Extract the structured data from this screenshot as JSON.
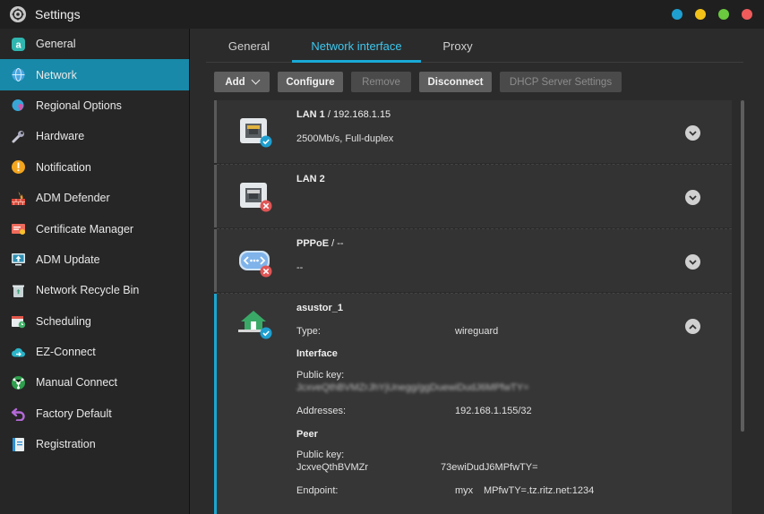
{
  "window": {
    "title": "Settings"
  },
  "window_controls": [
    {
      "name": "info-dot",
      "color": "#1e9fd0"
    },
    {
      "name": "minimize-dot",
      "color": "#f3c219"
    },
    {
      "name": "maximize-dot",
      "color": "#6ac93e"
    },
    {
      "name": "close-dot",
      "color": "#ef5b5b"
    }
  ],
  "sidebar": {
    "items": [
      {
        "label": "General",
        "icon": "general-icon",
        "active": false
      },
      {
        "label": "Network",
        "icon": "globe-icon",
        "active": true
      },
      {
        "label": "Regional Options",
        "icon": "globe-pin-icon",
        "active": false
      },
      {
        "label": "Hardware",
        "icon": "wrench-icon",
        "active": false
      },
      {
        "label": "Notification",
        "icon": "alert-icon",
        "active": false
      },
      {
        "label": "ADM Defender",
        "icon": "firewall-icon",
        "active": false
      },
      {
        "label": "Certificate Manager",
        "icon": "certificate-icon",
        "active": false
      },
      {
        "label": "ADM Update",
        "icon": "update-icon",
        "active": false
      },
      {
        "label": "Network Recycle Bin",
        "icon": "recycle-bin-icon",
        "active": false
      },
      {
        "label": "Scheduling",
        "icon": "calendar-icon",
        "active": false
      },
      {
        "label": "EZ-Connect",
        "icon": "cloud-icon",
        "active": false
      },
      {
        "label": "Manual Connect",
        "icon": "manual-connect-icon",
        "active": false
      },
      {
        "label": "Factory Default",
        "icon": "undo-icon",
        "active": false
      },
      {
        "label": "Registration",
        "icon": "registration-icon",
        "active": false
      }
    ]
  },
  "tabs": [
    {
      "label": "General",
      "active": false
    },
    {
      "label": "Network interface",
      "active": true
    },
    {
      "label": "Proxy",
      "active": false
    }
  ],
  "toolbar": {
    "add": "Add",
    "configure": "Configure",
    "remove": "Remove",
    "disconnect": "Disconnect",
    "dhcp": "DHCP Server Settings"
  },
  "interfaces": {
    "lan1": {
      "name": "LAN 1",
      "ip": " / 192.168.1.15",
      "detail": "2500Mb/s, Full-duplex",
      "status": "connected"
    },
    "lan2": {
      "name": "LAN 2",
      "status": "disconnected"
    },
    "pppoe": {
      "name": "PPPoE",
      "ip": " / --",
      "detail": "--",
      "status": "disconnected"
    },
    "vpn": {
      "name": "asustor_1",
      "status": "connected",
      "type_label": "Type:",
      "type_value": "wireguard",
      "interface_heading": "Interface",
      "public_key_label": "Public key:",
      "interface_public_key": "JcxveQthBVMZrJhYjUnegg/ggDuewiDudJ6MPfwTY=",
      "addresses_label": "Addresses:",
      "addresses_value": "192.168.1.155/32",
      "peer_heading": "Peer",
      "peer_public_key_label": "Public key:",
      "peer_public_key": "JcxveQthBVMZr",
      "peer_public_key_tail": "73ewiDudJ6MPfwTY=",
      "endpoint_label": "Endpoint:",
      "endpoint_value_head": "myx",
      "endpoint_value": "MPfwTY=.tz.ritz.net:1234"
    }
  },
  "colors": {
    "accent": "#19a9d6",
    "sidebar_active": "#1889a8",
    "ok_badge": "#1e9fd0",
    "error_badge": "#e05555"
  }
}
